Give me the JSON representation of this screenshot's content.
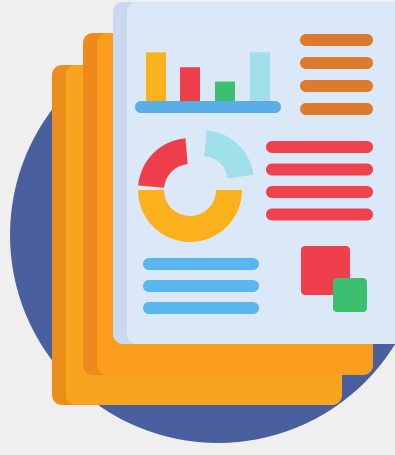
{
  "illustration": {
    "subject": "report-documents-icon",
    "colors": {
      "background": "#efefef",
      "circle": "#4a5f9e",
      "page_back": "#f7a51e",
      "page_back_shade": "#ec8e1c",
      "page_middle": "#fb9d1c",
      "page_middle_shade": "#ee8a1c",
      "page_front": "#dbe8f8",
      "page_front_edge": "#c9daf0",
      "bar_yellow": "#fbb11c",
      "bar_red": "#ef3f4c",
      "bar_green": "#3cbf6e",
      "bar_cyan": "#9fe0ea",
      "baseline_blue": "#5aaee8",
      "line_orange": "#dd7a2e",
      "line_red": "#f0414f",
      "line_blue": "#5ab6ee",
      "square_red": "#ef3f4c",
      "square_green": "#3cbf6e"
    },
    "bar_chart": {
      "values": [
        0.78,
        0.55,
        0.33,
        0.78
      ]
    },
    "donut_chart": {
      "segments": [
        {
          "color_key": "bar_yellow",
          "share": 0.5
        },
        {
          "color_key": "bar_red",
          "share": 0.25
        },
        {
          "color_key": "bar_cyan",
          "share": 0.2
        }
      ]
    },
    "text_line_groups": [
      {
        "color_key": "line_orange",
        "count": 4
      },
      {
        "color_key": "line_red",
        "count": 4
      },
      {
        "color_key": "line_blue",
        "count": 3
      }
    ]
  }
}
